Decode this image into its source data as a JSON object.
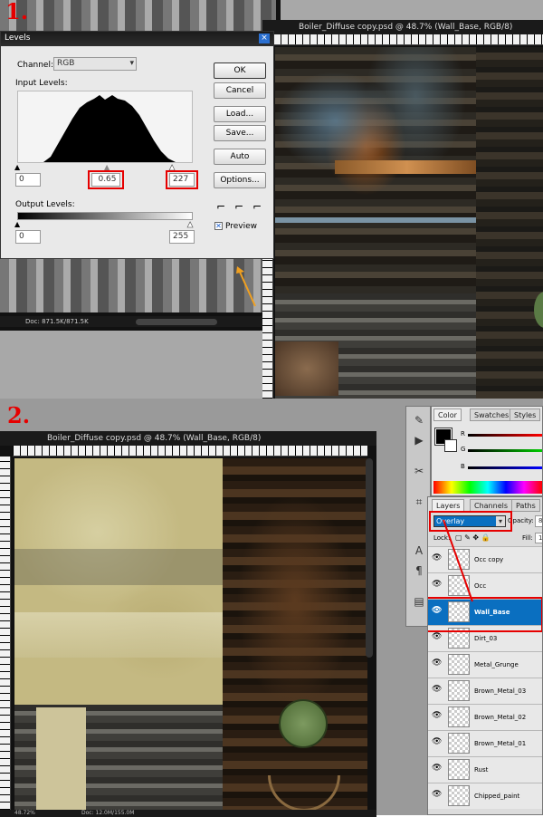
{
  "steps": {
    "step1": "1.",
    "step2": "2."
  },
  "top": {
    "doc_title": "Boiler_Diffuse copy.psd @ 48.7% (Wall_Base, RGB/8)",
    "ruler_labels": [
      "0",
      "50",
      "100",
      "150",
      "200",
      "250",
      "300"
    ],
    "bg_doc_status": "Doc: 871.5K/871.5K",
    "levels": {
      "title": "Levels",
      "channel_label": "Channel:",
      "channel_value": "RGB",
      "input_label": "Input Levels:",
      "input_black": "0",
      "input_gamma": "0.65",
      "input_white": "227",
      "output_label": "Output Levels:",
      "output_black": "0",
      "output_white": "255",
      "buttons": {
        "ok": "OK",
        "cancel": "Cancel",
        "load": "Load...",
        "save": "Save...",
        "auto": "Auto",
        "options": "Options..."
      },
      "preview_label": "Preview",
      "preview_checked": true
    }
  },
  "bottom": {
    "doc_title": "Boiler_Diffuse copy.psd @ 48.7% (Wall_Base, RGB/8)",
    "ruler_labels": [
      "0",
      "50",
      "100",
      "150",
      "200",
      "250",
      "300",
      "350",
      "400",
      "450",
      "500",
      "550",
      "600",
      "650",
      "700",
      "750",
      "800",
      "850",
      "900",
      "950",
      "1000"
    ],
    "zoom": "48.72%",
    "doc_status": "Doc: 12.0M/155.0M",
    "color_tabs": [
      "Color",
      "Swatches",
      "Styles"
    ],
    "sliders": [
      "R",
      "G",
      "B"
    ],
    "layer_tabs": [
      "Layers",
      "Channels",
      "Paths"
    ],
    "blend_mode": "Overlay",
    "opacity_label": "Opacity:",
    "opacity_value": "89",
    "lock_label": "Lock:",
    "fill_label": "Fill:",
    "fill_value": "10",
    "layers": [
      "Occ copy",
      "Occ",
      "Wall_Base",
      "Dirt_03",
      "Metal_Grunge",
      "Brown_Metal_03",
      "Brown_Metal_02",
      "Brown_Metal_01",
      "Rust",
      "Chipped_paint"
    ],
    "selected_layer": "Wall_Base",
    "tools": [
      "brush-icon",
      "play-icon",
      "lasso-icon",
      "crop-icon",
      "text-icon",
      "paragraph-icon",
      "file-icon"
    ],
    "accent_red": "#e60000",
    "selection_blue": "#0a6fc0"
  }
}
